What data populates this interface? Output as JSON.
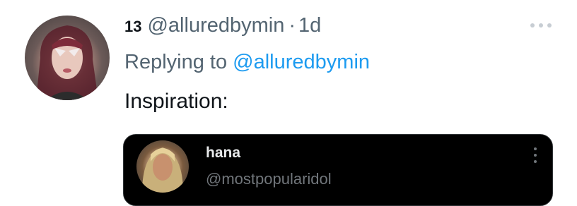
{
  "tweet": {
    "display_name": "13",
    "handle": "@alluredbymin",
    "separator": "·",
    "time": "1d",
    "replying_prefix": "Replying to",
    "replying_handle": "@alluredbymin",
    "text": "Inspiration:"
  },
  "quote": {
    "display_name": "hana",
    "handle": "@mostpopularidol"
  },
  "colors": {
    "accent": "#1d9bf0",
    "muted": "#536471",
    "quote_background": "#000000"
  },
  "icons": {
    "more_top": "more-horizontal-icon",
    "more_quote": "more-vertical-icon"
  }
}
